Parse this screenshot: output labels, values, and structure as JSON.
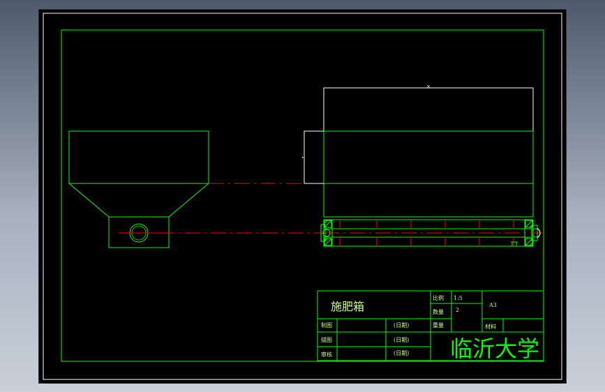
{
  "title_block": {
    "part_name": "施肥箱",
    "scale_label": "比例",
    "scale_value": "1:5",
    "qty_label": "数量",
    "qty_value": "2",
    "sheet_size": "A3",
    "weight_label": "重量",
    "material_label": "材料",
    "drawn_label": "制图",
    "checked_label": "描图",
    "approved_label": "审核",
    "date_label": "(日期)",
    "school": "临沂大学"
  },
  "colors": {
    "outline": "#00ff00",
    "centerline": "#ff0000",
    "dimension": "#ffffff",
    "background": "#000000"
  }
}
